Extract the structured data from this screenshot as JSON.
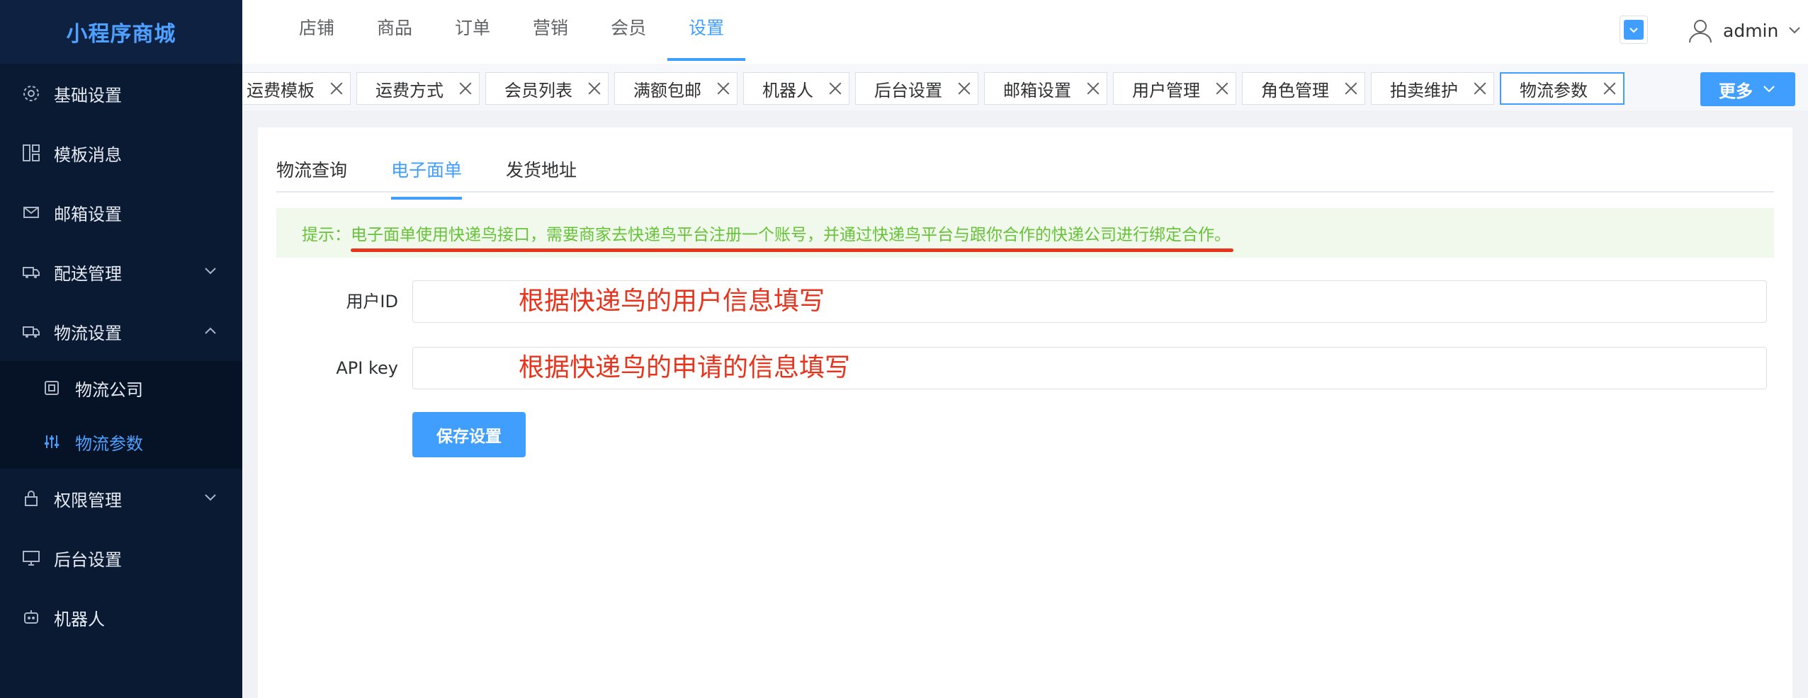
{
  "sidebar": {
    "logo": "小程序商城",
    "items": [
      {
        "label": "基础设置",
        "icon": "gear-icon"
      },
      {
        "label": "模板消息",
        "icon": "template-icon"
      },
      {
        "label": "邮箱设置",
        "icon": "mail-icon"
      },
      {
        "label": "配送管理",
        "icon": "delivery-icon"
      },
      {
        "label": "物流设置",
        "icon": "truck-icon"
      },
      {
        "label": "权限管理",
        "icon": "lock-icon"
      },
      {
        "label": "后台设置",
        "icon": "monitor-icon"
      },
      {
        "label": "机器人",
        "icon": "robot-icon"
      }
    ],
    "submenu": [
      {
        "label": "物流公司",
        "icon": "company-icon"
      },
      {
        "label": "物流参数",
        "icon": "sliders-icon"
      }
    ]
  },
  "header": {
    "nav": [
      "店铺",
      "商品",
      "订单",
      "营销",
      "会员",
      "设置"
    ],
    "active_nav": "设置",
    "user": "admin"
  },
  "tags": [
    "运费模板",
    "运费方式",
    "会员列表",
    "满额包邮",
    "机器人",
    "后台设置",
    "邮箱设置",
    "用户管理",
    "角色管理",
    "拍卖维护",
    "物流参数"
  ],
  "more_label": "更多",
  "tabs": [
    "物流查询",
    "电子面单",
    "发货地址"
  ],
  "tip": {
    "prefix": "提示：",
    "text": "电子面单使用快递鸟接口，需要商家去快递鸟平台注册一个账号，并通过快递鸟平台与跟你合作的快递公司进行绑定合作。"
  },
  "form": {
    "user_id_label": "用户ID",
    "user_id_annotation": "根据快递鸟的用户信息填写",
    "api_key_label": "API key",
    "api_key_annotation": "根据快递鸟的申请的信息填写",
    "save_label": "保存设置"
  },
  "colors": {
    "sidebar_bg": "#0b1a33",
    "accent": "#409eff",
    "tip_text": "#67c23a",
    "annotation": "#e8341c"
  }
}
